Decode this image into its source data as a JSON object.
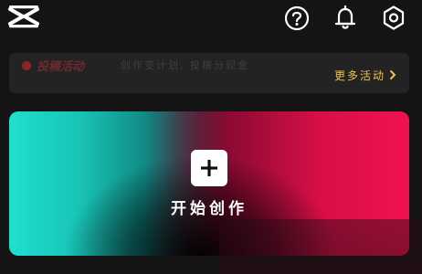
{
  "topbar": {
    "logo_icon": "capcut-logo-icon",
    "help_icon": "question-circle-icon",
    "notifications_icon": "bell-icon",
    "settings_icon": "hexagon-gear-icon"
  },
  "banner": {
    "title": "投稿活动",
    "description": "创作变计划, 投稿分现金",
    "more_label": "更多活动",
    "more_icon": "chevron-right-icon"
  },
  "create_card": {
    "label": "开始创作",
    "plus_icon": "plus-icon"
  },
  "colors": {
    "background": "#141414",
    "banner_bg": "#232323",
    "accent_gold": "#f0c24a",
    "gradient_teal": "#1ee0cf",
    "gradient_pink": "#f0124e"
  }
}
